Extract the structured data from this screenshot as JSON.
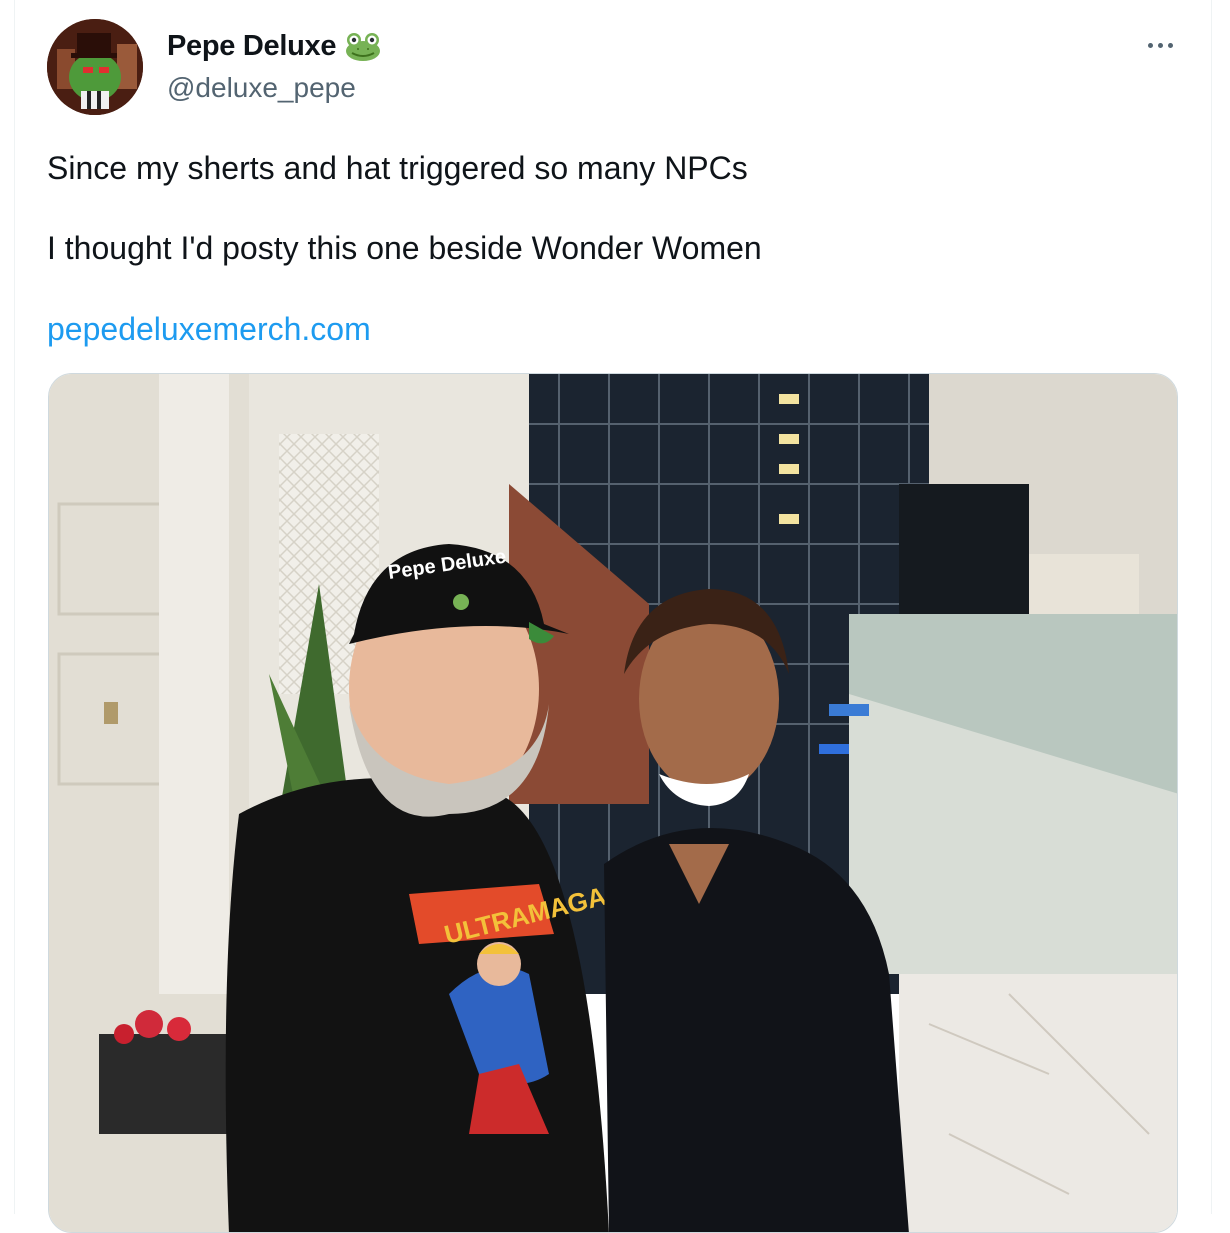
{
  "tweet": {
    "author": {
      "display_name": "Pepe Deluxe",
      "handle": "@deluxe_pepe",
      "badge_icon": "frog-face-icon",
      "avatar_icon": "pepe-frog-avatar"
    },
    "more_icon": "more-options-icon",
    "text_lines": [
      "Since my sherts and hat triggered so many NPCs",
      "I thought I'd posty this one beside Wonder Women"
    ],
    "link_text": "pepedeluxemerch.com",
    "media": {
      "hat_text": "Pepe Deluxe",
      "shirt_text": "ULTRAMAGA"
    }
  },
  "colors": {
    "link": "#1d9bf0",
    "secondary_text": "#536471",
    "primary_text": "#0f1419",
    "border": "#cfd9de",
    "frog_green": "#77b255"
  }
}
